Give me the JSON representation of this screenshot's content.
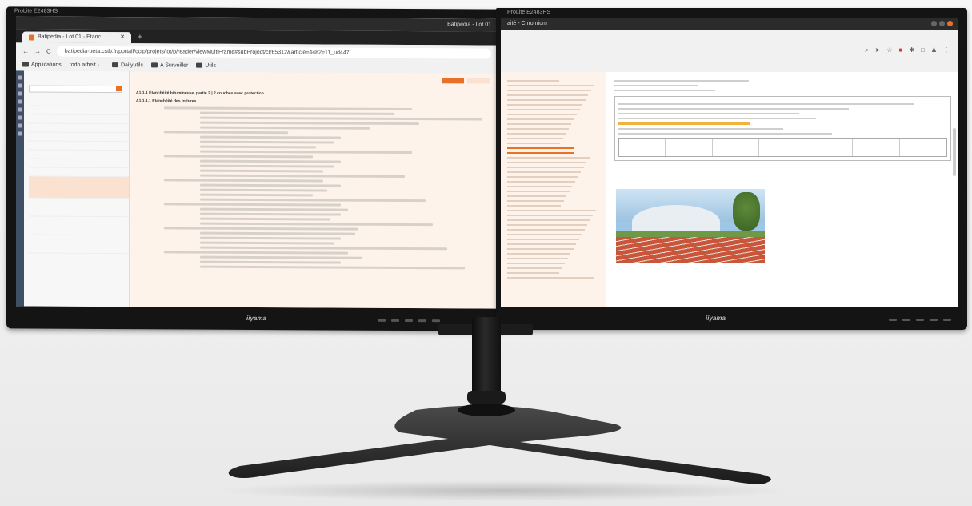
{
  "scene": {
    "description_label": "",
    "colors": {
      "accent": "#e8712a",
      "bezel": "#141414",
      "background": "#eeeeee"
    }
  },
  "left_monitor": {
    "model": "ProLite E2483HS",
    "brand": "iiyama",
    "window_title": "Batipedia - Lot 01",
    "tab_label": "Batipedia - Lot 01 - Etanc",
    "url": "batipedia-beta.cstb.fr/portail/cctp/projets/lot/p/reader/viewMultiFrame#subProject/clr65312&article=4482=11_ud447",
    "bookmarks": [
      "Applications",
      "todo arbeit -...",
      "Dailyutils",
      "A Surveiller",
      "Utils"
    ],
    "doc_heading": "A1.1.1 Etanchéité bitumineuse, partie 2 | 2 couches avec protection",
    "doc_subheading": "A1.1.1.1 Etanchéité des toitures"
  },
  "right_monitor": {
    "model": "ProLite E2483HS",
    "brand": "iiyama",
    "window_title": "aité - Chromium"
  }
}
